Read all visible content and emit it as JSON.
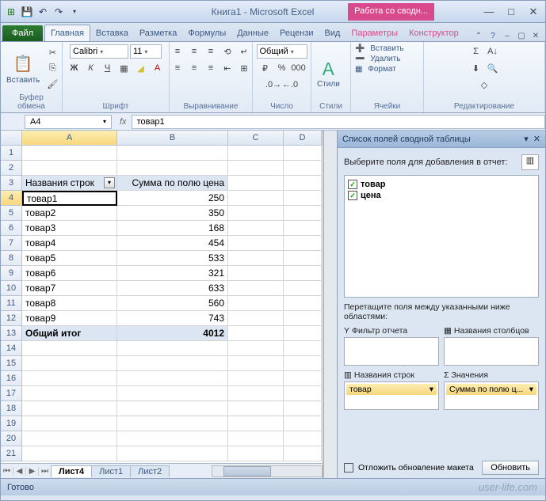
{
  "titlebar": {
    "app_title": "Книга1  -  Microsoft Excel",
    "context_tab": "Работа со сводн..."
  },
  "tabs": {
    "file": "Файл",
    "items": [
      "Главная",
      "Вставка",
      "Разметка",
      "Формулы",
      "Данные",
      "Рецензи",
      "Вид",
      "Параметры",
      "Конструктор"
    ],
    "active_index": 0
  },
  "ribbon": {
    "clipboard": {
      "label": "Буфер обмена",
      "paste": "Вставить"
    },
    "font": {
      "label": "Шрифт",
      "name": "Calibri",
      "size": "11",
      "bold": "Ж",
      "italic": "К",
      "underline": "Ч"
    },
    "align": {
      "label": "Выравнивание"
    },
    "number": {
      "label": "Число",
      "format": "Общий"
    },
    "styles": {
      "label": "Стили",
      "btn": "Стили"
    },
    "cells": {
      "label": "Ячейки",
      "insert": "Вставить",
      "delete": "Удалить",
      "format": "Формат"
    },
    "editing": {
      "label": "Редактирование"
    }
  },
  "formula_bar": {
    "name_box": "A4",
    "fx": "fx",
    "formula": "товар1"
  },
  "columns": [
    "A",
    "B",
    "C",
    "D"
  ],
  "grid": {
    "header_row": {
      "a": "Названия строк",
      "b": "Сумма по полю цена"
    },
    "rows": [
      {
        "n": 4,
        "a": "товар1",
        "b": "250"
      },
      {
        "n": 5,
        "a": "товар2",
        "b": "350"
      },
      {
        "n": 6,
        "a": "товар3",
        "b": "168"
      },
      {
        "n": 7,
        "a": "товар4",
        "b": "454"
      },
      {
        "n": 8,
        "a": "товар5",
        "b": "533"
      },
      {
        "n": 9,
        "a": "товар6",
        "b": "321"
      },
      {
        "n": 10,
        "a": "товар7",
        "b": "633"
      },
      {
        "n": 11,
        "a": "товар8",
        "b": "560"
      },
      {
        "n": 12,
        "a": "товар9",
        "b": "743"
      }
    ],
    "grand_total": {
      "n": 13,
      "a": "Общий итог",
      "b": "4012"
    }
  },
  "sheets": {
    "tabs": [
      "Лист4",
      "Лист1",
      "Лист2"
    ],
    "active_index": 0
  },
  "pane": {
    "title": "Список полей сводной таблицы",
    "prompt": "Выберите поля для добавления в отчет:",
    "fields": [
      {
        "name": "товар",
        "checked": true
      },
      {
        "name": "цена",
        "checked": true
      }
    ],
    "drag_label": "Перетащите поля между указанными ниже областями:",
    "areas": {
      "filter": "Фильтр отчета",
      "columns": "Названия столбцов",
      "rows": "Названия строк",
      "values": "Значения",
      "rows_item": "товар",
      "values_item": "Сумма по полю ц..."
    },
    "defer": "Отложить обновление макета",
    "update": "Обновить"
  },
  "status": {
    "ready": "Готово"
  },
  "watermark": "user-life.com"
}
